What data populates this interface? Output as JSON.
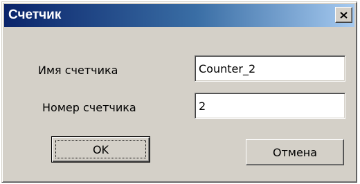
{
  "window": {
    "title": "Счетчик",
    "close_icon": "close-icon"
  },
  "form": {
    "name_label": "Имя счетчика",
    "name_value": "Counter_2",
    "number_label": "Номер счетчика",
    "number_value": "2"
  },
  "buttons": {
    "ok_label": "OK",
    "cancel_label": "Отмена"
  },
  "colors": {
    "dialog_bg": "#d4d0c8",
    "titlebar_start": "#0a246a",
    "titlebar_end": "#a6caf0",
    "title_text": "#ffffff"
  }
}
